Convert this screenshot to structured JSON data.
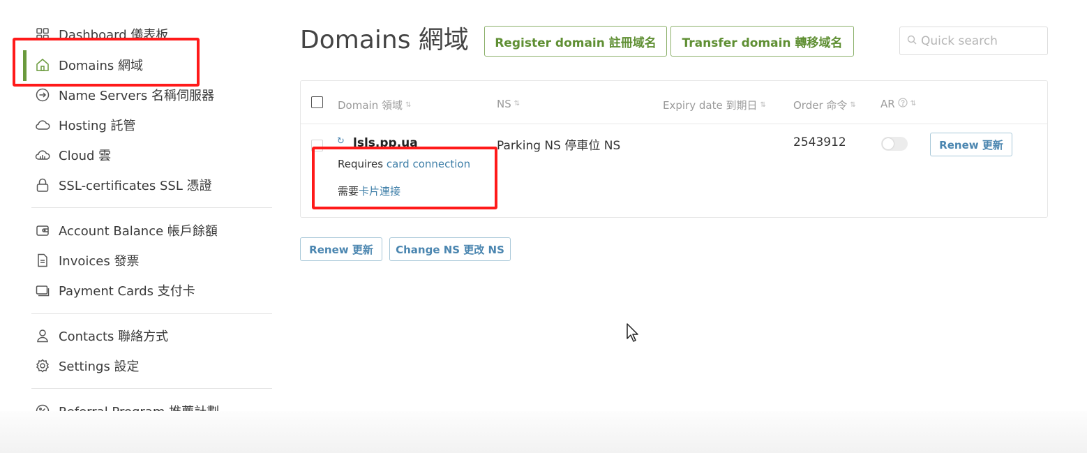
{
  "sidebar": {
    "items": [
      {
        "label": "Dashboard  儀表板",
        "icon": "dashboard-grid-icon"
      },
      {
        "label": "Domains  網域",
        "icon": "home-icon"
      },
      {
        "label": "Name Servers  名稱伺服器",
        "icon": "arrow-circle-icon"
      },
      {
        "label": "Hosting  託管",
        "icon": "cloud-outline-icon"
      },
      {
        "label": "Cloud  雲",
        "icon": "cloud-gauge-icon"
      },
      {
        "label": "SSL-certificates  SSL 憑證",
        "icon": "lock-icon"
      },
      {
        "label": "Account Balance  帳戶餘額",
        "icon": "wallet-icon"
      },
      {
        "label": "Invoices  發票",
        "icon": "document-icon"
      },
      {
        "label": "Payment Cards  支付卡",
        "icon": "cards-icon"
      },
      {
        "label": "Contacts  聯絡方式",
        "icon": "person-icon"
      },
      {
        "label": "Settings  設定",
        "icon": "gear-icon"
      },
      {
        "label": "Referral Program  推薦計劃",
        "icon": "percent-icon"
      }
    ],
    "active_item": "Domains  網域"
  },
  "header": {
    "title": "Domains  網域",
    "register_button": "Register domain  註冊域名",
    "transfer_button": "Transfer domain  轉移域名",
    "search_placeholder": "Quick search"
  },
  "table": {
    "columns": [
      "Domain  領域",
      "NS",
      "Expiry date  到期日",
      "Order  命令",
      "AR"
    ],
    "rows": [
      {
        "domain": "lsls.pp.ua",
        "ns": "Parking NS  停車位 NS",
        "expiry": "",
        "order": "2543912",
        "ar_enabled": false,
        "renew_button": "Renew  更新",
        "note_en_prefix": "Requires ",
        "note_en_link": "card connection",
        "note_zh_prefix": "需要",
        "note_zh_link": "卡片連接"
      }
    ]
  },
  "bulk_actions": {
    "renew": "Renew  更新",
    "change_ns": "Change NS  更改 NS"
  },
  "colors": {
    "accent_green": "#5f8f33",
    "link_blue": "#3f7fa8",
    "highlight_red": "#ff1a1a"
  }
}
